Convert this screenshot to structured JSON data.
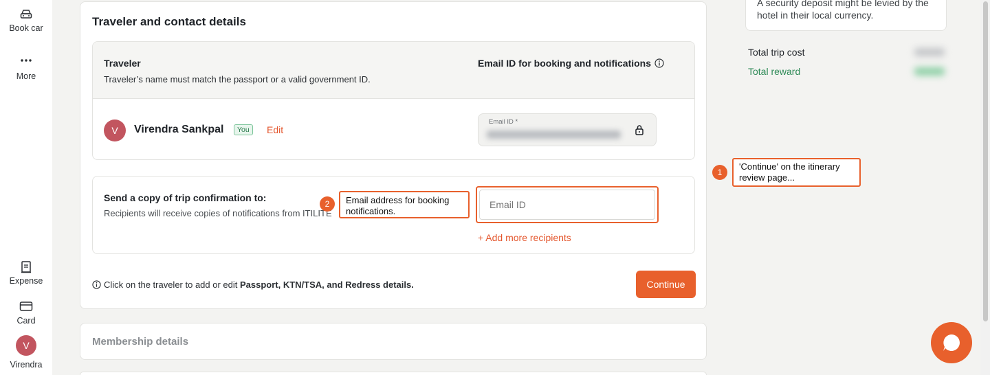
{
  "nav": {
    "book_car": "Book car",
    "more": "More",
    "expense": "Expense",
    "card": "Card",
    "user_initial": "V",
    "user_name": "Virendra"
  },
  "main": {
    "title": "Traveler and contact details",
    "traveler_header": "Traveler",
    "traveler_subtitle": "Traveler’s name must match the passport or a valid government ID.",
    "email_header": "Email ID for booking and notifications",
    "traveler": {
      "initial": "V",
      "name": "Virendra Sankpal",
      "badge": "You",
      "edit": "Edit",
      "email_label": "Email ID *"
    },
    "copy": {
      "title": "Send a copy of trip confirmation to:",
      "subtitle": "Recipients will receive copies of notifications from ITILITE",
      "email_placeholder": "Email ID",
      "add_more": "+ Add more recipients"
    },
    "footnote_prefix": "Click on the traveler to add or edit ",
    "footnote_bold": "Passport, KTN/TSA, and Redress details.",
    "continue": "Continue",
    "membership": "Membership details"
  },
  "summary": {
    "deposit_note": "A security deposit might be levied by the hotel in their local currency.",
    "total_trip_cost": "Total trip cost",
    "total_reward": "Total reward"
  },
  "annotations": {
    "note1_num": "1",
    "note1_text": "'Continue' on the itinerary review page...",
    "note2_num": "2",
    "note2_text": "Email address for booking notifications."
  },
  "colors": {
    "accent": "#e8602c",
    "reward_green": "#2e8a57",
    "avatar": "#c2555f"
  }
}
